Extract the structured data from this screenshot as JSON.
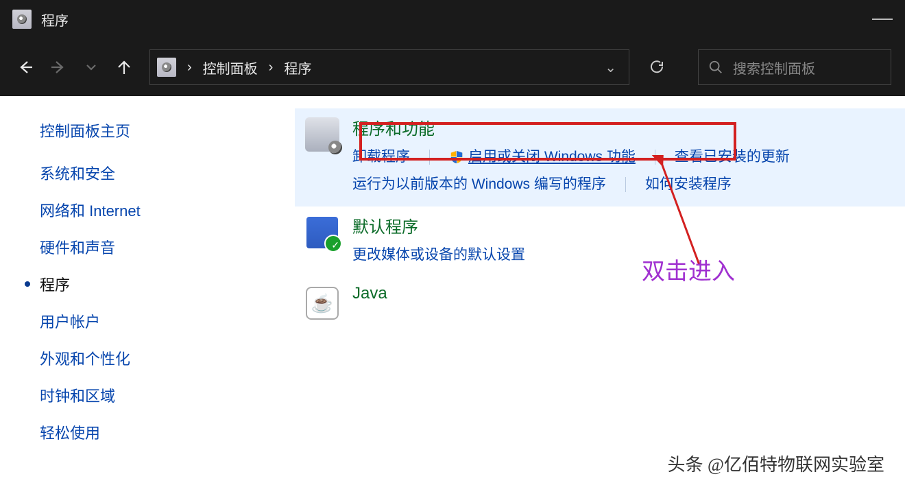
{
  "titlebar": {
    "title": "程序"
  },
  "breadcrumb": {
    "root": "控制面板",
    "current": "程序"
  },
  "search": {
    "placeholder": "搜索控制面板"
  },
  "sidebar": {
    "home": "控制面板主页",
    "items": [
      {
        "label": "系统和安全"
      },
      {
        "label": "网络和 Internet"
      },
      {
        "label": "硬件和声音"
      },
      {
        "label": "程序",
        "active": true
      },
      {
        "label": "用户帐户"
      },
      {
        "label": "外观和个性化"
      },
      {
        "label": "时钟和区域"
      },
      {
        "label": "轻松使用"
      }
    ]
  },
  "sections": {
    "programs": {
      "title": "程序和功能",
      "links": {
        "uninstall": "卸载程序",
        "features": "启用或关闭 Windows 功能",
        "updates": "查看已安装的更新",
        "compat": "运行为以前版本的 Windows 编写的程序",
        "howto": "如何安装程序"
      }
    },
    "defaults": {
      "title": "默认程序",
      "links": {
        "media": "更改媒体或设备的默认设置"
      }
    },
    "java": {
      "title": "Java"
    }
  },
  "annotation": {
    "label": "双击进入"
  },
  "watermark": {
    "text": "头条 @亿佰特物联网实验室"
  }
}
